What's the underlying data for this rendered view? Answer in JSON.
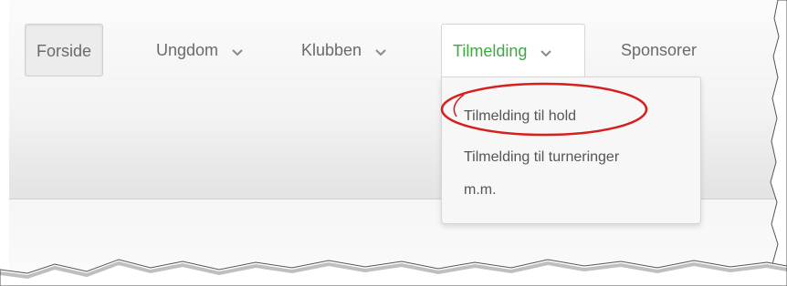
{
  "nav": {
    "items": [
      {
        "label": "Forside",
        "state": "active"
      },
      {
        "label": "Ungdom",
        "has_dropdown": true
      },
      {
        "label": "Klubben",
        "has_dropdown": true
      },
      {
        "label": "Tilmelding",
        "has_dropdown": true,
        "state": "open"
      },
      {
        "label": "Sponsorer"
      }
    ]
  },
  "dropdown": {
    "items": [
      {
        "label": "Tilmelding til hold",
        "highlighted": true
      },
      {
        "label_line1": "Tilmelding til turneringer",
        "label_line2": "m.m."
      }
    ]
  },
  "colors": {
    "accent_green": "#3daa3d",
    "highlight_red": "#d61f1f",
    "text_gray": "#6a6a6a"
  },
  "icons": {
    "chevron": "chevron-down-icon"
  }
}
